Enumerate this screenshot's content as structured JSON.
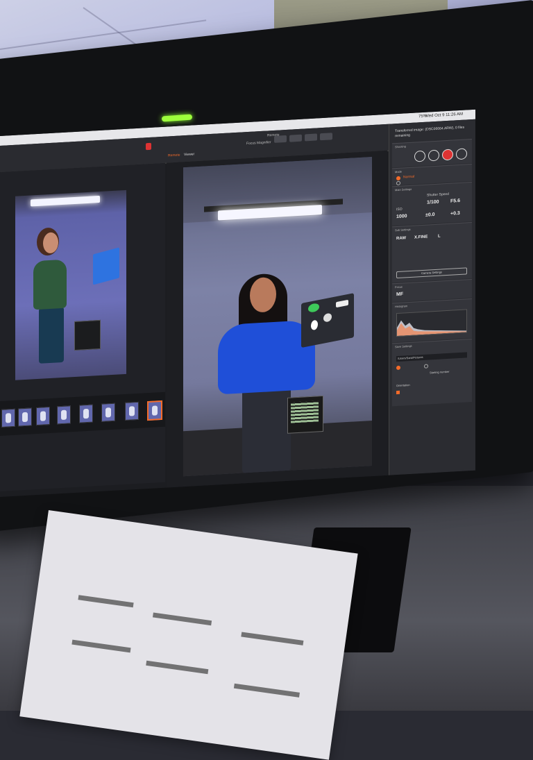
{
  "screen": {
    "menubar": {
      "clock": "Wed Oct 9  11:26 AM",
      "battery": "75%"
    },
    "app": {
      "title": "Remote",
      "tabs": [
        {
          "label": "Remote"
        },
        {
          "label": "Viewer"
        }
      ],
      "focus_magnifier_label": "Focus Magnifier"
    },
    "right_panel": {
      "transfer_info": "Transferred image: (DSC06664.ARW), 0 files remaining",
      "sections": {
        "shooting": "Shooting",
        "mode": "Mode",
        "mode_value": "Normal",
        "main_settings": "Main Settings",
        "shutter_speed_label": "Shutter Speed",
        "shutter_speed": "1/100",
        "aperture": "F5.6",
        "iso_label": "ISO",
        "iso": "1000",
        "ev": "±0.0",
        "flash_comp": "+0.3",
        "sub_settings": "Sub Settings",
        "format": "RAW",
        "quality": "X.FINE",
        "size": "L",
        "camera_settings_button": "Camera Settings",
        "focus": "Focus",
        "focus_mode": "MF",
        "histogram": "Histogram",
        "save_settings": "Save Settings",
        "save_path": "/Users/Sara/Pictures",
        "starting_number": "Starting number",
        "orientation": "Orientation"
      }
    }
  },
  "scene": {
    "colors": {
      "accent": "#f36b2a",
      "sweater": "#1f4fd8",
      "backdrop": "#7d82a6",
      "webcam_led": "#9dff3c"
    }
  }
}
